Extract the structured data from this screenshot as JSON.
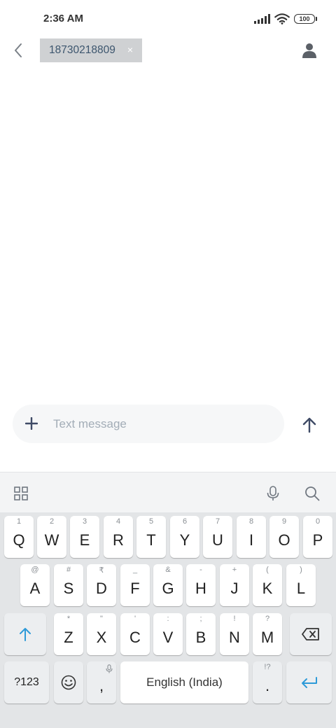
{
  "status_bar": {
    "time": "2:36 AM",
    "battery": "100",
    "icons": [
      "signal-icon",
      "wifi-icon",
      "battery-icon"
    ]
  },
  "header": {
    "back_icon": "chevron-left-icon",
    "recipient": "18730218809",
    "chip_close": "×",
    "contact_icon": "person-icon"
  },
  "composer": {
    "placeholder": "Text message",
    "value": "",
    "attach_icon": "plus-icon",
    "send_icon": "arrow-up-icon"
  },
  "keyboard": {
    "toolbar_icons": [
      "grid-icon",
      "mic-icon",
      "search-icon"
    ],
    "row1": [
      {
        "main": "Q",
        "hint": "1"
      },
      {
        "main": "W",
        "hint": "2"
      },
      {
        "main": "E",
        "hint": "3"
      },
      {
        "main": "R",
        "hint": "4"
      },
      {
        "main": "T",
        "hint": "5"
      },
      {
        "main": "Y",
        "hint": "6"
      },
      {
        "main": "U",
        "hint": "7"
      },
      {
        "main": "I",
        "hint": "8"
      },
      {
        "main": "O",
        "hint": "9"
      },
      {
        "main": "P",
        "hint": "0"
      }
    ],
    "row2": [
      {
        "main": "A",
        "hint": "@"
      },
      {
        "main": "S",
        "hint": "#"
      },
      {
        "main": "D",
        "hint": "₹"
      },
      {
        "main": "F",
        "hint": "_"
      },
      {
        "main": "G",
        "hint": "&"
      },
      {
        "main": "H",
        "hint": "-"
      },
      {
        "main": "J",
        "hint": "+"
      },
      {
        "main": "K",
        "hint": "("
      },
      {
        "main": "L",
        "hint": ")"
      }
    ],
    "row3": [
      {
        "main": "Z",
        "hint": "*"
      },
      {
        "main": "X",
        "hint": "\""
      },
      {
        "main": "C",
        "hint": "'"
      },
      {
        "main": "V",
        "hint": ":"
      },
      {
        "main": "B",
        "hint": ";"
      },
      {
        "main": "N",
        "hint": "!"
      },
      {
        "main": "M",
        "hint": "?"
      }
    ],
    "symbols_label": "?123",
    "comma_label": ",",
    "space_label": "English (India)",
    "period_label": ".",
    "period_hint": "!?",
    "accent_color": "#2d9ad8"
  }
}
